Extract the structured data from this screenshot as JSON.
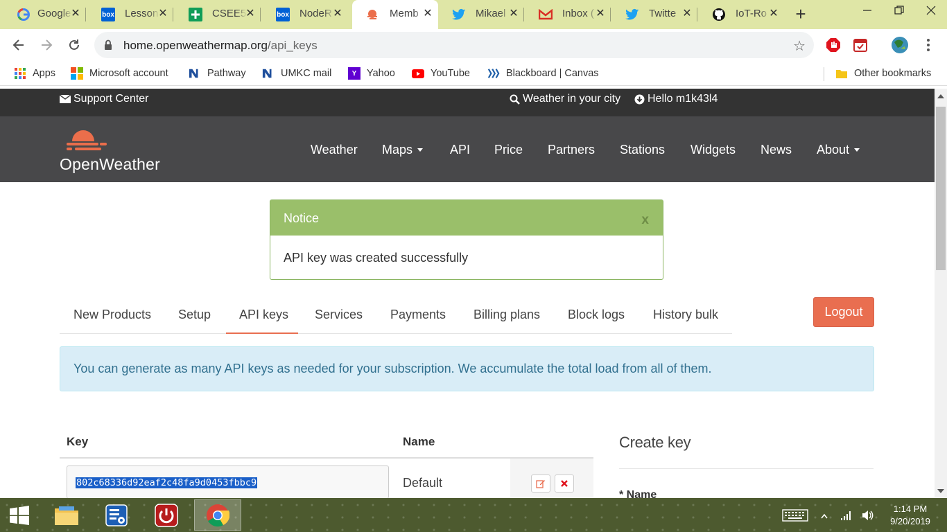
{
  "browser": {
    "tabs": [
      {
        "title": "Google",
        "icon": "google-icon",
        "active": false
      },
      {
        "title": "Lesson",
        "icon": "box-icon",
        "active": false
      },
      {
        "title": "CSEE5",
        "icon": "sheets-icon",
        "active": false
      },
      {
        "title": "NodeR",
        "icon": "box-icon",
        "active": false
      },
      {
        "title": "Memb",
        "icon": "openweather-icon",
        "active": true
      },
      {
        "title": "Mikael",
        "icon": "twitter-icon",
        "active": false
      },
      {
        "title": "Inbox (",
        "icon": "gmail-icon",
        "active": false
      },
      {
        "title": "Twitte",
        "icon": "twitter-icon",
        "active": false
      },
      {
        "title": "IoT-Ro",
        "icon": "github-icon",
        "active": false
      }
    ],
    "url_host": "home.openweathermap.org",
    "url_path": "/api_keys",
    "bookmarks": [
      {
        "label": "Apps"
      },
      {
        "label": "Microsoft account"
      },
      {
        "label": "Pathway"
      },
      {
        "label": "UMKC mail"
      },
      {
        "label": "Yahoo"
      },
      {
        "label": "YouTube"
      },
      {
        "label": "Blackboard | Canvas"
      }
    ],
    "other_bookmarks": "Other bookmarks"
  },
  "site": {
    "topbar": {
      "support": "Support Center",
      "weather_city": "Weather in your city",
      "hello": "Hello m1k43l4"
    },
    "logo_text": "OpenWeather",
    "nav": [
      "Weather",
      "Maps",
      "API",
      "Price",
      "Partners",
      "Stations",
      "Widgets",
      "News",
      "About"
    ],
    "notice": {
      "title": "Notice",
      "close": "x",
      "message": "API key was created successfully"
    },
    "subtabs": [
      "New Products",
      "Setup",
      "API keys",
      "Services",
      "Payments",
      "Billing plans",
      "Block logs",
      "History bulk"
    ],
    "logout": "Logout",
    "info": "You can generate as many API keys as needed for your subscription. We accumulate the total load from all of them.",
    "keys": {
      "col_key": "Key",
      "col_name": "Name",
      "rows": [
        {
          "key": "802c68336d92eaf2c48fa9d0453fbbc9",
          "name": "Default"
        }
      ]
    },
    "create": {
      "title": "Create key",
      "name_label": "* Name"
    }
  },
  "taskbar": {
    "time": "1:14 PM",
    "date": "9/20/2019"
  }
}
